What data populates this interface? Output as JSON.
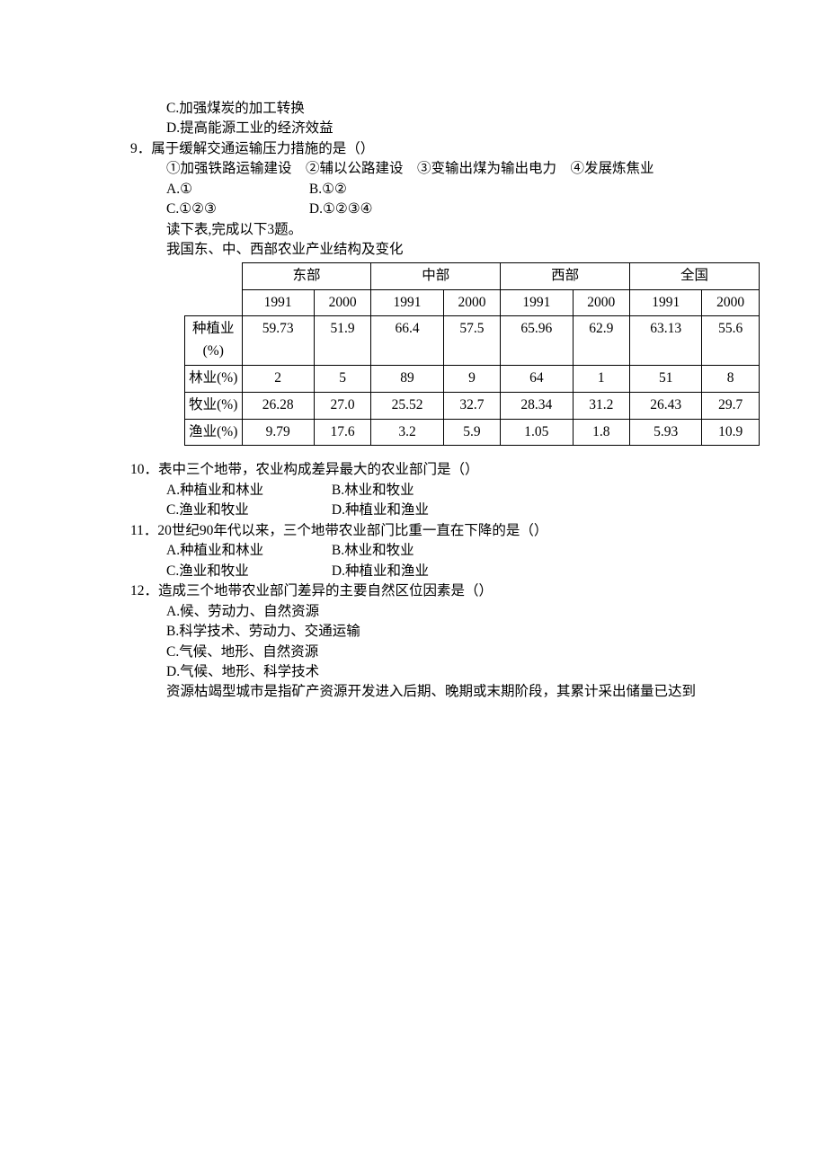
{
  "lines": {
    "opt8c": "C.加强煤炭的加工转换",
    "opt8d": "D.提高能源工业的经济效益",
    "q9": "9．属于缓解交通运输压力措施的是（）",
    "q9sub": "①加强铁路运输建设　②辅以公路建设　③变输出煤为输出电力　④发展炼焦业",
    "q9a": "A.①",
    "q9b": "B.①②",
    "q9c": "C.①②③",
    "q9d": "D.①②③④",
    "lead3": "读下表,完成以下3题。",
    "tcaption": "我国东、中、西部农业产业结构及变化",
    "q10": "10．表中三个地带，农业构成差异最大的农业部门是（）",
    "q10a": "A.种植业和林业",
    "q10b": "B.林业和牧业",
    "q10c": "C.渔业和牧业",
    "q10d": "D.种植业和渔业",
    "q11": "11．20世纪90年代以来，三个地带农业部门比重一直在下降的是（）",
    "q11a": "A.种植业和林业",
    "q11b": "B.林业和牧业",
    "q11c": "C.渔业和牧业",
    "q11d": "D.种植业和渔业",
    "q12": "12．造成三个地带农业部门差异的主要自然区位因素是（）",
    "q12a": "A.候、劳动力、自然资源",
    "q12b": "B.科学技术、劳动力、交通运输",
    "q12c": "C.气候、地形、自然资源",
    "q12d": "D.气候、地形、科学技术",
    "lead_next": "资源枯竭型城市是指矿产资源开发进入后期、晚期或末期阶段，其累计采出储量已达到"
  },
  "table": {
    "col_regions": [
      "东部",
      "中部",
      "西部",
      "全国"
    ],
    "year_cols": [
      [
        "1991",
        "2000"
      ],
      [
        "1991",
        "2000"
      ],
      [
        "1991",
        "2000"
      ],
      [
        "1991",
        "2000"
      ]
    ],
    "rows": [
      {
        "label": "种植业(%)",
        "cells": [
          "59.73",
          "51.9",
          "66.4",
          "57.5",
          "65.96",
          "62.9",
          "63.13",
          "55.6"
        ]
      },
      {
        "label": "林业(%)",
        "cells": [
          "2",
          "5",
          "89",
          "9",
          "64",
          "1",
          "51",
          "8"
        ]
      },
      {
        "label": "牧业(%)",
        "cells": [
          "26.28",
          "27.0",
          "25.52",
          "32.7",
          "28.34",
          "31.2",
          "26.43",
          "29.7"
        ]
      },
      {
        "label": "渔业(%)",
        "cells": [
          "9.79",
          "17.6",
          "3.2",
          "5.9",
          "1.05",
          "1.8",
          "5.93",
          "10.9"
        ]
      }
    ]
  }
}
